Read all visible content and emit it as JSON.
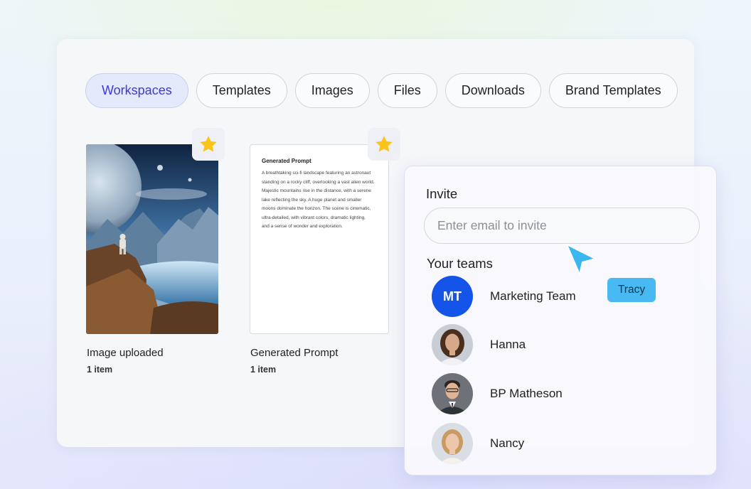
{
  "tabs": [
    {
      "label": "Workspaces",
      "active": true
    },
    {
      "label": "Templates",
      "active": false
    },
    {
      "label": "Images",
      "active": false
    },
    {
      "label": "Files",
      "active": false
    },
    {
      "label": "Downloads",
      "active": false
    },
    {
      "label": "Brand Templates",
      "active": false
    }
  ],
  "cards": [
    {
      "title": "Image uploaded",
      "count": "1 item",
      "favorite": true
    },
    {
      "title": "Generated Prompt",
      "count": "1 item",
      "favorite": true,
      "doc_title": "Generated Prompt",
      "doc_lines": [
        "A breathtaking sci-fi landscape featuring an astronaut",
        "standing on a rocky cliff, overlooking a vast alien world.",
        "Majestic mountains rise in the distance, with a serene",
        "lake reflecting the sky. A huge planet and smaller",
        "moons dominate the horizon. The scene is cinematic,",
        "ultra-detailed, with vibrant colors, dramatic lighting,",
        "and a sense of wonder and exploration."
      ]
    }
  ],
  "invite": {
    "heading": "Invite",
    "placeholder": "Enter email to invite",
    "teams_heading": "Your teams",
    "members": [
      {
        "name": "Marketing Team",
        "initials": "MT",
        "avatar": "initials-avatar"
      },
      {
        "name": "Hanna",
        "avatar": "photo-avatar"
      },
      {
        "name": "BP Matheson",
        "avatar": "photo-avatar"
      },
      {
        "name": "Nancy",
        "avatar": "photo-avatar"
      }
    ],
    "cursor_tag": "Tracy"
  },
  "colors": {
    "accent": "#3d3ad6",
    "active_tab_bg": "#e4e9fb",
    "team_avatar": "#1454e8",
    "cursor": "#3bb6f0",
    "star": "#fcc419"
  }
}
